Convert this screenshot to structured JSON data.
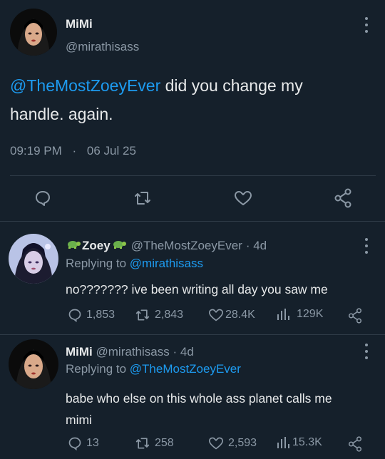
{
  "main_tweet": {
    "display_name": "MiMi",
    "handle": "@mirathisass",
    "mention": "@TheMostZoeyEver",
    "text_line1": " did you change my",
    "text_line2": "handle. again.",
    "time": "09:19 PM",
    "dot": "·",
    "date": "06 Jul 25"
  },
  "reply1": {
    "display_name": "Zoey",
    "handle": "@TheMostZoeyEver",
    "age": "· 4d",
    "replying_prefix": "Replying to ",
    "replying_to": "@mirathisass",
    "text": "no??????? ive been writing all day you saw me",
    "stats": {
      "replies": "1,853",
      "retweets": "2,843",
      "likes": "28.4K",
      "views": "129K"
    }
  },
  "reply2": {
    "display_name": "MiMi",
    "handle": "@mirathisass",
    "age": "· 4d",
    "replying_prefix": "Replying to ",
    "replying_to": "@TheMostZoeyEver",
    "text_line1": "babe who else on this whole ass planet calls me",
    "text_line2": "mimi",
    "stats": {
      "replies": "13",
      "retweets": "258",
      "likes": "2,593",
      "views": "15.3K"
    }
  },
  "icons": [
    "reply-icon",
    "retweet-icon",
    "like-icon",
    "share-icon",
    "views-icon",
    "turtle-emoji-icon",
    "more-icon"
  ],
  "colors": {
    "background": "#15202b",
    "link": "#1d9bf0",
    "muted": "#8b98a5",
    "text": "#e7e9ea"
  }
}
